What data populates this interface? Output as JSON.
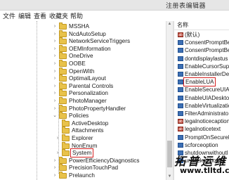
{
  "window": {
    "title": "注册表编辑器"
  },
  "menu": [
    "文件",
    "编辑",
    "查看",
    "收藏夹",
    "帮助"
  ],
  "tree": [
    {
      "label": "MSSHA",
      "arrow": "›",
      "level": 0
    },
    {
      "label": "NcdAutoSetup",
      "arrow": "›",
      "level": 0
    },
    {
      "label": "NetworkServiceTriggers",
      "arrow": "›",
      "level": 0
    },
    {
      "label": "OEMInformation",
      "arrow": "›",
      "level": 0
    },
    {
      "label": "OneDrive",
      "arrow": "›",
      "level": 0
    },
    {
      "label": "OOBE",
      "arrow": "›",
      "level": 0
    },
    {
      "label": "OpenWith",
      "arrow": "›",
      "level": 0
    },
    {
      "label": "OptimalLayout",
      "arrow": "›",
      "level": 0
    },
    {
      "label": "Parental Controls",
      "arrow": "›",
      "level": 0
    },
    {
      "label": "Personalization",
      "arrow": "›",
      "level": 0
    },
    {
      "label": "PhotoManager",
      "arrow": "›",
      "level": 0
    },
    {
      "label": "PhotoPropertyHandler",
      "arrow": "›",
      "level": 0
    },
    {
      "label": "Policies",
      "arrow": "⌄",
      "level": 0
    },
    {
      "label": "ActiveDesktop",
      "arrow": "",
      "level": 1
    },
    {
      "label": "Attachments",
      "arrow": "",
      "level": 1
    },
    {
      "label": "Explorer",
      "arrow": "›",
      "level": 1
    },
    {
      "label": "NonEnum",
      "arrow": "",
      "level": 1
    },
    {
      "label": "System",
      "arrow": "›",
      "level": 1,
      "selected": true
    },
    {
      "label": "PowerEfficiencyDiagnostics",
      "arrow": "›",
      "level": 0
    },
    {
      "label": "PrecisionTouchPad",
      "arrow": "›",
      "level": 0
    },
    {
      "label": "Prelaunch",
      "arrow": "›",
      "level": 0
    }
  ],
  "values_header": "名称",
  "values": [
    {
      "name": "(默认)",
      "type": "str"
    },
    {
      "name": "ConsentPromptBe",
      "type": "bin"
    },
    {
      "name": "ConsentPromptBe",
      "type": "bin"
    },
    {
      "name": "dontdisplaylastus",
      "type": "bin"
    },
    {
      "name": "EnableCursorSupp",
      "type": "bin"
    },
    {
      "name": "EnableInstallerDete",
      "type": "bin"
    },
    {
      "name": "EnableLUA",
      "type": "bin",
      "selected": true
    },
    {
      "name": "EnableSecureUIAP",
      "type": "bin"
    },
    {
      "name": "EnableUIADesktop",
      "type": "bin"
    },
    {
      "name": "EnableVirtualizatio",
      "type": "bin"
    },
    {
      "name": "FilterAdministrato",
      "type": "bin"
    },
    {
      "name": "legalnoticecaption",
      "type": "str"
    },
    {
      "name": "legalnoticetext",
      "type": "str"
    },
    {
      "name": "PromptOnSecureD",
      "type": "bin"
    },
    {
      "name": "scforceoption",
      "type": "bin"
    },
    {
      "name": "shutdownwithoutl",
      "type": "bin"
    },
    {
      "name": "undockwithoutlo",
      "type": "bin"
    }
  ],
  "watermark": {
    "line1": "拓普运维",
    "line2": "www.tlltd.cn"
  }
}
